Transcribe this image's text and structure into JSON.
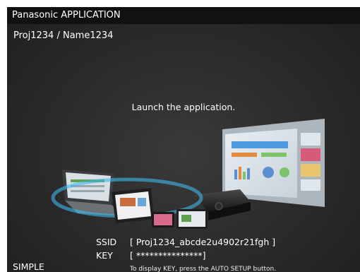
{
  "window": {
    "title": "Panasonic APPLICATION"
  },
  "breadcrumb": "Proj1234 / Name1234",
  "message": "Launch the application.",
  "ssid": {
    "label": "SSID",
    "value": "[ Proj1234_abcde2u4902r21fgh ]"
  },
  "key": {
    "label": "KEY",
    "value": "[ ***************]"
  },
  "hint": "To display KEY, press the AUTO SETUP button.",
  "mode": "SIMPLE"
}
